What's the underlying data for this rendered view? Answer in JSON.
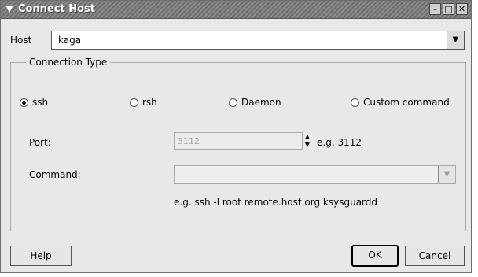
{
  "window": {
    "title": "Connect Host",
    "menu_icon": "chevron-down-icon",
    "minimize_glyph": "–",
    "maximize_glyph": "□",
    "close_glyph": "✕"
  },
  "host": {
    "label": "Host",
    "value": "kaga"
  },
  "connection_type": {
    "title": "Connection Type",
    "options": [
      {
        "label": "ssh",
        "selected": true
      },
      {
        "label": "rsh",
        "selected": false
      },
      {
        "label": "Daemon",
        "selected": false
      },
      {
        "label": "Custom command",
        "selected": false
      }
    ]
  },
  "port": {
    "label": "Port:",
    "value": "3112",
    "example": "e.g.  3112"
  },
  "command": {
    "label": "Command:",
    "value": "",
    "example": "e.g. ssh -l root remote.host.org ksysguardd"
  },
  "buttons": {
    "help": "Help",
    "ok": "OK",
    "cancel": "Cancel"
  },
  "icons": {
    "dropdown": "▼",
    "spin_up": "▲",
    "spin_down": "▼"
  }
}
